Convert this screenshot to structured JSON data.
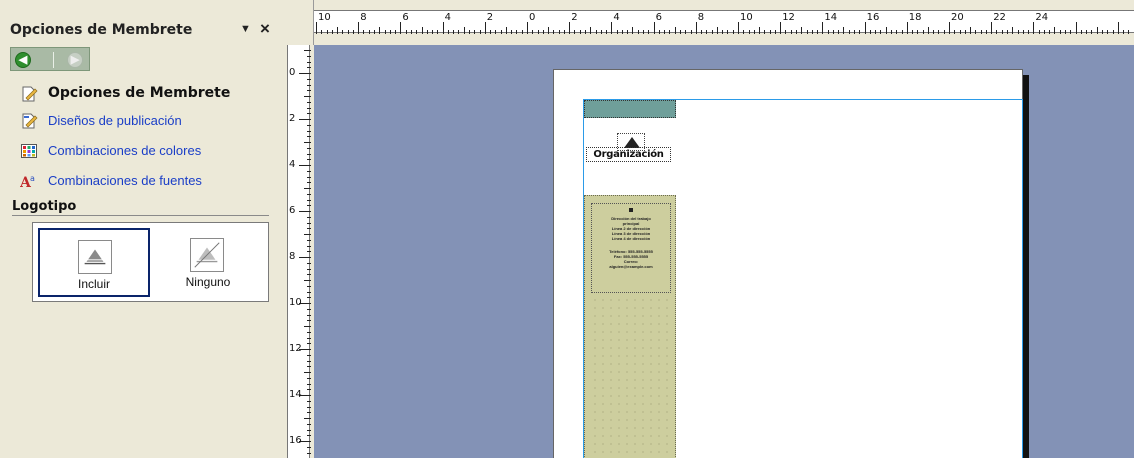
{
  "task_pane": {
    "title": "Opciones de Membrete",
    "dropdown_glyph": "▼",
    "close_glyph": "×",
    "nav": {
      "back_glyph": "◀",
      "forward_glyph": "▶"
    },
    "links": [
      {
        "label": "Opciones de Membrete",
        "icon": "doc-pencil-icon"
      },
      {
        "label": "Diseños de publicación",
        "icon": "doc-pencil-icon"
      },
      {
        "label": "Combinaciones de colores",
        "icon": "color-grid-icon"
      },
      {
        "label": "Combinaciones de fuentes",
        "icon": "font-a-icon"
      }
    ],
    "logo_section": {
      "heading": "Logotipo",
      "selected": "Incluir",
      "options": [
        {
          "label": "Incluir"
        },
        {
          "label": "Ninguno"
        }
      ]
    }
  },
  "rulers": {
    "horizontal": [
      "10",
      "8",
      "6",
      "4",
      "2",
      "0",
      "2",
      "4",
      "6",
      "8",
      "10",
      "12",
      "14",
      "16",
      "18",
      "20",
      "22",
      "24"
    ],
    "vertical": [
      "0",
      "2",
      "4",
      "6",
      "8",
      "10",
      "12",
      "14",
      "16"
    ]
  },
  "document": {
    "organization": "Organización",
    "side_lines": [
      "Dirección del trabajo",
      "principal",
      "Línea 2 de dirección",
      "Línea 3 de dirección",
      "Línea 4 de dirección",
      "",
      "Teléfono: 555-555-5555",
      "Fax: 555-555-5555",
      "Correo:",
      "alguien@example.com"
    ]
  },
  "colors": {
    "canvas": "#8392B6",
    "pane_bg": "#ECE9D8",
    "link": "#1A3EC7",
    "band_green": "#CDCE9E",
    "bar_teal": "#6F9F9A",
    "margin_guide": "#2B9BE8"
  }
}
